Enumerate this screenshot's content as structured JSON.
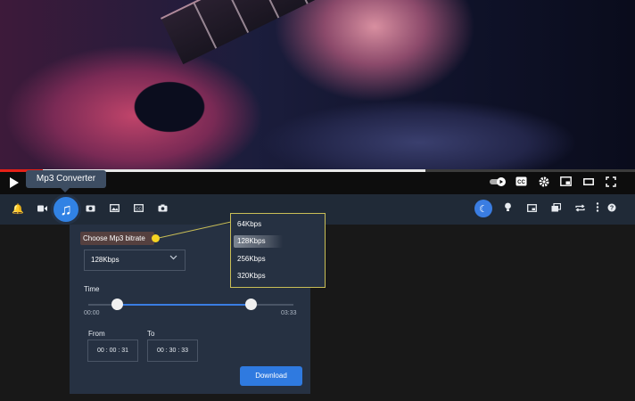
{
  "tooltip": {
    "text": "Mp3 Converter"
  },
  "video_controls": {
    "play_icon": "play-icon",
    "right_icons": [
      "autoplay-toggle-icon",
      "cc-icon",
      "settings-icon",
      "miniplayer-icon",
      "theater-icon",
      "fullscreen-icon"
    ],
    "played_fraction": 0.67
  },
  "toolbar": {
    "left_icons": [
      "bell-icon",
      "video-camera-icon",
      "music-note-icon",
      "media-folder-icon",
      "picture-icon",
      "cc-icon",
      "camera-icon"
    ],
    "right_icons": [
      "moon-icon",
      "bulb-icon",
      "pip-icon",
      "copy-icon",
      "repeat-icon",
      "more-icon",
      "help-icon"
    ]
  },
  "converter": {
    "bitrate_label": "Choose Mp3 bitrate",
    "bitrate_selected": "128Kbps",
    "time_label": "Time",
    "start_time": "00:00",
    "end_time": "03:33",
    "from_label": "From",
    "to_label": "To",
    "from_value": "00 : 00 : 31",
    "to_value": "00 : 30 : 33",
    "download_label": "Download"
  },
  "dropdown": {
    "options": [
      "64Kbps",
      "128Kbps",
      "256Kbps",
      "320Kbps"
    ],
    "selected_index": 1
  },
  "colors": {
    "accent": "#3182e4",
    "panel": "#263142",
    "toolbar": "#202a37",
    "highlight": "#f5d322"
  }
}
